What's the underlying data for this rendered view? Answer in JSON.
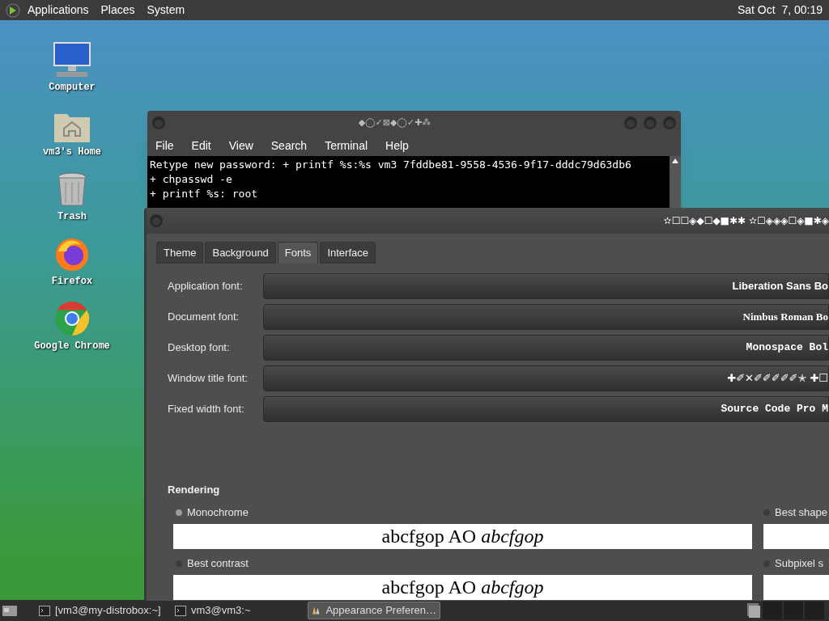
{
  "top_panel": {
    "menus": [
      "Applications",
      "Places",
      "System"
    ],
    "clock": "Sat Oct  7, 00:19"
  },
  "desktop_icons": [
    {
      "kind": "computer",
      "label": "Computer"
    },
    {
      "kind": "home",
      "label": "vm3's Home"
    },
    {
      "kind": "trash",
      "label": "Trash"
    },
    {
      "kind": "firefox",
      "label": "Firefox"
    },
    {
      "kind": "chrome",
      "label": "Google Chrome"
    }
  ],
  "terminal": {
    "title": "◆◯✓⊠◆◯✓✚⁂",
    "menu": [
      "File",
      "Edit",
      "View",
      "Search",
      "Terminal",
      "Help"
    ],
    "lines": [
      "Retype new password: + printf %s:%s vm3 7fddbe81-9558-4536-9f17-dddc79d63db6",
      "+ chpasswd -e",
      "+ printf %s: root"
    ]
  },
  "appearance": {
    "title": "✫☐☐◈◆☐◆■✱✱ ✫☐◈◈◈☐◈■✱◈",
    "tabs": [
      {
        "label": "Theme",
        "selected": false
      },
      {
        "label": "Background",
        "selected": false
      },
      {
        "label": "Fonts",
        "selected": true
      },
      {
        "label": "Interface",
        "selected": false
      }
    ],
    "fonts": [
      {
        "label": "Application font:",
        "value": "Liberation Sans Bo",
        "kind": "sans"
      },
      {
        "label": "Document font:",
        "value": "Nimbus Roman Bo",
        "kind": "serif"
      },
      {
        "label": "Desktop font:",
        "value": "Monospace Bol",
        "kind": "mono"
      },
      {
        "label": "Window title font:",
        "value": "✚✐✕✐✐✐✐✐✭ ✚☐",
        "kind": "symbol"
      },
      {
        "label": "Fixed width font:",
        "value": "Source Code Pro M",
        "kind": "mono"
      }
    ],
    "rendering": {
      "heading": "Rendering",
      "options": [
        {
          "label": "Monochrome",
          "selected": true,
          "sample": "abcfgop AO *abcfgop*"
        },
        {
          "label": "Best shape",
          "selected": false
        },
        {
          "label": "Best contrast",
          "selected": false,
          "sample": "abcfgop AO *abcfgop*"
        },
        {
          "label": "Subpixel s",
          "selected": false
        }
      ]
    }
  },
  "taskbar": {
    "items": [
      {
        "kind": "terminal",
        "label": "[vm3@my-distrobox:~]",
        "selected": false
      },
      {
        "kind": "terminal",
        "label": "vm3@vm3:~",
        "selected": false
      },
      {
        "kind": "appearance",
        "label": "Appearance Preferen…",
        "selected": true
      }
    ]
  }
}
